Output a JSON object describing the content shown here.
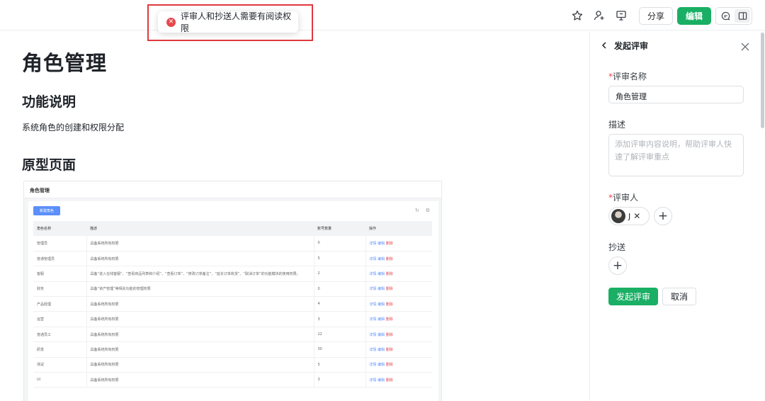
{
  "toast": {
    "message": "评审人和抄送人需要有阅读权限"
  },
  "topbar": {
    "icons": [
      "star-icon",
      "add-collaborator-icon",
      "present-icon"
    ],
    "share_label": "分享",
    "edit_label": "编辑",
    "toggle_icons": [
      "comment-icon",
      "side-panel-icon"
    ]
  },
  "doc": {
    "title": "角色管理",
    "section1_heading": "功能说明",
    "section1_text": "系统角色的创建和权限分配",
    "section2_heading": "原型页面",
    "prototype": {
      "page_title": "角色管理",
      "new_button": "新建角色",
      "headers": [
        "角色名称",
        "描述",
        "账号数量",
        "操作"
      ],
      "rows": [
        [
          "管理员",
          "具备系统所有权限",
          "0"
        ],
        [
          "普通管理员",
          "具备系统所有权限",
          "5"
        ],
        [
          "客服",
          "具备“进入在线客服”、“查看商品列表和介绍”、“查看订单”、“修改订单备注”、“延长订单收货”、“取消订单”的功能模块的使用权限。",
          "2"
        ],
        [
          "财务",
          "具备“资产管理”等相关功能的管理权限",
          "0"
        ],
        [
          "产品经理",
          "具备系统所有权限",
          "4"
        ],
        [
          "运营",
          "具备系统所有权限",
          "3"
        ],
        [
          "普通员工",
          "具备系统所有权限",
          "12"
        ],
        [
          "研发",
          "具备系统所有权限",
          "30"
        ],
        [
          "测试",
          "具备系统所有权限",
          "5"
        ],
        [
          "UI",
          "具备系统所有权限",
          "3"
        ]
      ],
      "actions": [
        "详情",
        "编辑",
        "删除"
      ]
    }
  },
  "panel": {
    "title": "发起评审",
    "name_label": "评审名称",
    "name_value": "角色管理",
    "desc_label": "描述",
    "desc_placeholder": "添加评审内容说明，帮助评审人快速了解评审重点",
    "reviewer_label": "评审人",
    "reviewer_initial": "J",
    "cc_label": "抄送",
    "submit_label": "发起评审",
    "cancel_label": "取消"
  }
}
